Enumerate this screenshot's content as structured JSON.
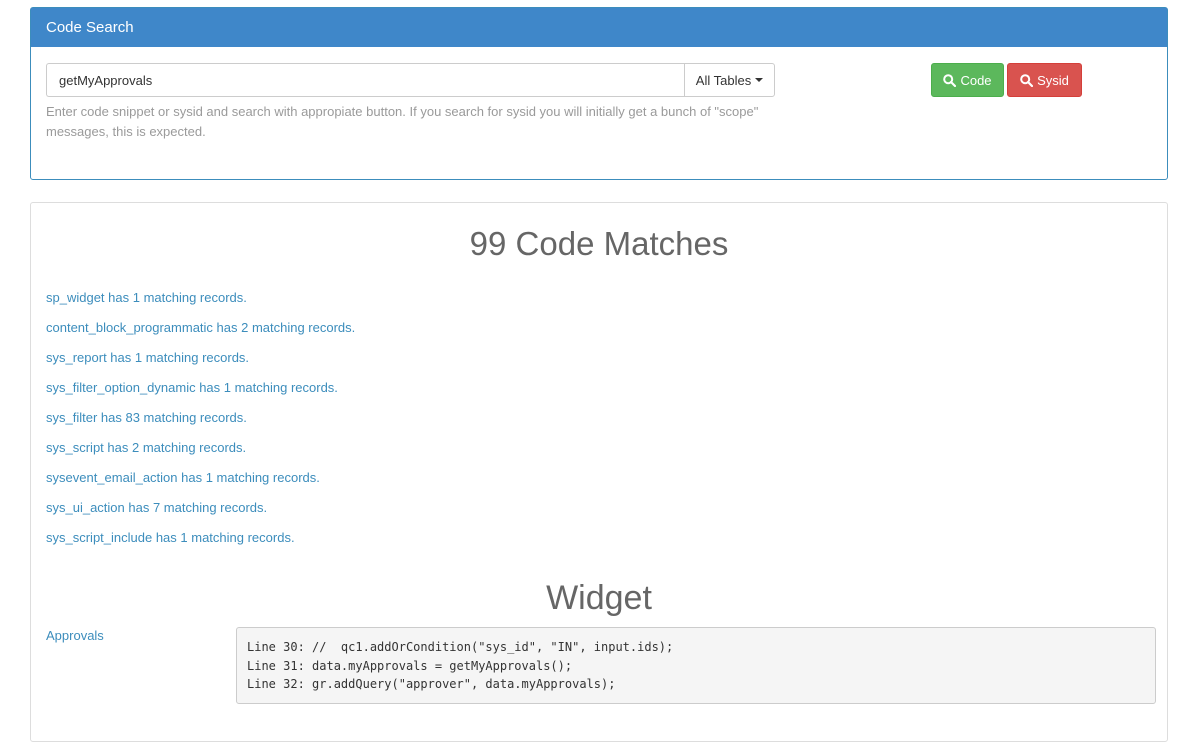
{
  "search": {
    "header": "Code Search",
    "query": "getMyApprovals",
    "table_dropdown_label": "All Tables",
    "help_text": "Enter code snippet or sysid and search with appropiate button. If you search for sysid you will initially get a bunch of \"scope\" messages, this is expected.",
    "code_button_label": "Code",
    "sysid_button_label": "Sysid",
    "code_button_color": "#5cb85c",
    "sysid_button_color": "#d9534f",
    "code_button_icon": "search-icon",
    "sysid_button_icon": "search-icon"
  },
  "results": {
    "title": "99 Code Matches",
    "matches": [
      "sp_widget has 1 matching records.",
      "content_block_programmatic has 2 matching records.",
      "sys_report has 1 matching records.",
      "sys_filter_option_dynamic has 1 matching records.",
      "sys_filter has 83 matching records.",
      "sys_script has 2 matching records.",
      "sysevent_email_action has 1 matching records.",
      "sys_ui_action has 7 matching records.",
      "sys_script_include has 1 matching records."
    ],
    "section_title": "Widget",
    "record_name": "Approvals",
    "code_lines": [
      "Line 30: //  qc1.addOrCondition(\"sys_id\", \"IN\", input.ids);",
      "Line 31: data.myApprovals = getMyApprovals();",
      "Line 32: gr.addQuery(\"approver\", data.myApprovals);"
    ]
  },
  "colors": {
    "header_bg": "#3f87c9",
    "link": "#3c8dbc"
  }
}
